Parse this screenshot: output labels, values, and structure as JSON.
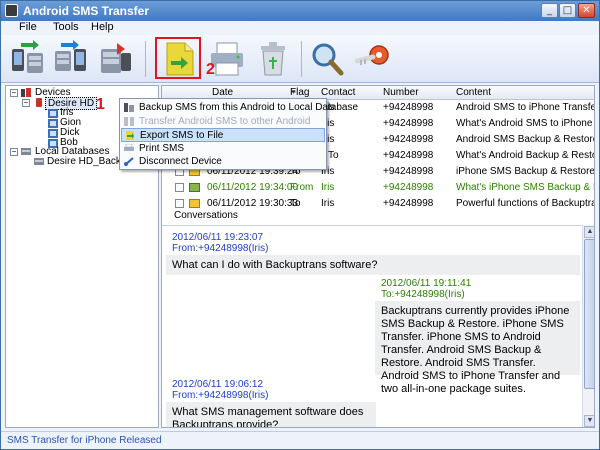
{
  "window": {
    "title": "Android SMS Transfer"
  },
  "menu": [
    "File",
    "Tools",
    "Help"
  ],
  "toolbar": {
    "buttons": [
      "backup-icon",
      "restore-icon",
      "database-icon",
      "export-icon",
      "print-icon",
      "delete-icon",
      "search-icon",
      "key-icon"
    ]
  },
  "callouts": {
    "one": "1",
    "two": "2"
  },
  "tree": {
    "devices_label": "Devices",
    "device_name": "Desire HD",
    "contacts": [
      "Iris",
      "Gion",
      "Dick",
      "Bob"
    ],
    "local_db_label": "Local Databases",
    "local_db_item": "Desire HD_Backup_Fil"
  },
  "messages": {
    "columns": [
      "Date",
      "Flag",
      "Contact",
      "Number",
      "Content"
    ],
    "rows": [
      {
        "date": "",
        "flag": "",
        "contact": "Iris",
        "number": "+94248998",
        "content": "Android SMS to iPhone Transfer i..."
      },
      {
        "date": "",
        "flag": "",
        "contact": "Iris",
        "number": "+94248998",
        "content": "What's Android SMS to iPhone Tr..."
      },
      {
        "date": "",
        "flag": "",
        "contact": "Iris",
        "number": "+94248998",
        "content": "Android SMS Backup & Restore c..."
      },
      {
        "date": "",
        "flag": "To",
        "contact": "Iris",
        "number": "+94248998",
        "content": "What's Android Backup & Restore."
      },
      {
        "date": "06/11/2012 19:39:24",
        "flag": "To",
        "contact": "Iris",
        "number": "+94248998",
        "content": "iPhone SMS Backup & Restore ca..."
      },
      {
        "date": "06/11/2012 19:34:00",
        "flag": "From",
        "contact": "Iris",
        "number": "+94248998",
        "content": "What's iPhone SMS Backup & Res..."
      },
      {
        "date": "06/11/2012 19:30:33",
        "flag": "To",
        "contact": "Iris",
        "number": "+94248998",
        "content": "Powerful functions of Backuptrans..."
      }
    ]
  },
  "conversation": {
    "tab_label": "Conversations",
    "items": [
      {
        "time": "2012/06/11 19:23:07",
        "from": "From:+94248998(Iris)",
        "text": "What can I do with Backuptrans software?"
      },
      {
        "time": "2012/06/11 19:11:41",
        "from": "To:+94248998(Iris)",
        "text": "Backuptrans currently provides iPhone SMS Backup & Restore. iPhone SMS Transfer. iPhone SMS to Android Transfer. Android SMS Backup & Restore. Android SMS Transfer. Android SMS to iPhone Transfer and two all-in-one package suites."
      },
      {
        "time": "2012/06/11 19:06:12",
        "from": "From:+94248998(Iris)",
        "text": "What SMS management software does Backuptrans provide?"
      }
    ]
  },
  "context_menu": {
    "items": [
      {
        "label": "Backup SMS from this Android to Local Database",
        "state": "normal"
      },
      {
        "label": "Transfer Android SMS to other Android",
        "state": "disabled"
      },
      {
        "label": "Export SMS to File",
        "state": "hover"
      },
      {
        "label": "Print SMS",
        "state": "normal"
      },
      {
        "label": "Disconnect Device",
        "state": "normal"
      }
    ]
  },
  "status_bar": {
    "text": "SMS Transfer for iPhone Released"
  },
  "colors": {
    "accent": "#3f79c6",
    "callout_red": "#e0161e",
    "from_text": "#1c3fc4",
    "to_text": "#2b7f00"
  }
}
